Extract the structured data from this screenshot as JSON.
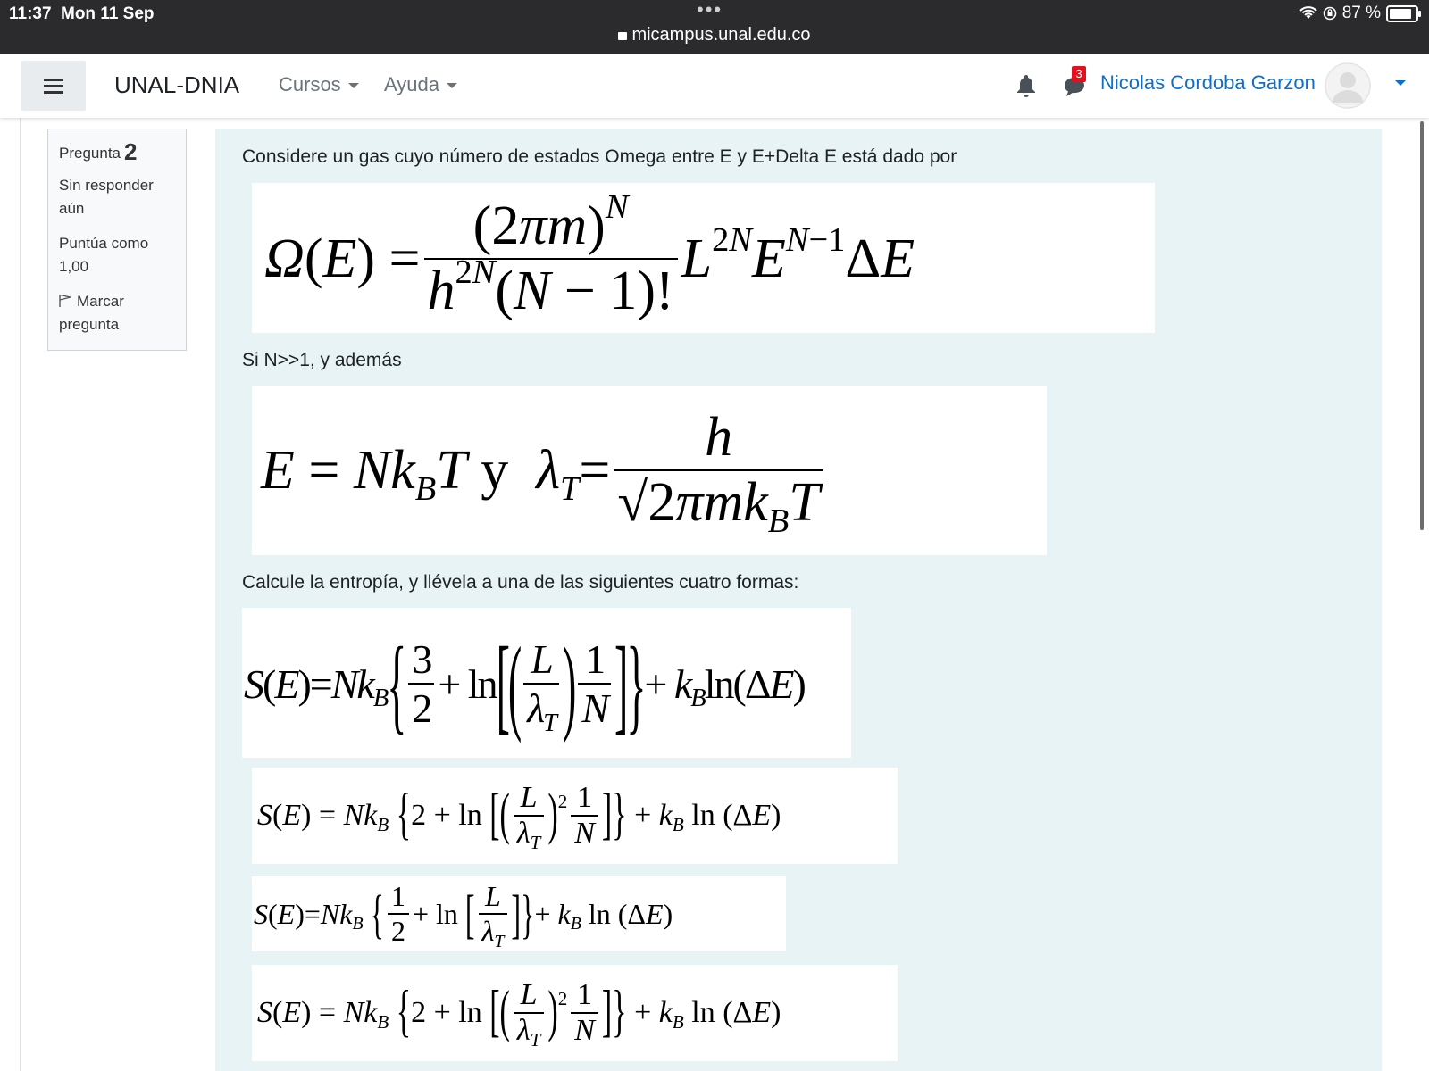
{
  "status_bar": {
    "time": "11:37",
    "date": "Mon 11 Sep",
    "url": "micampus.unal.edu.co",
    "battery": "87 %",
    "battery_level": 0.87
  },
  "navbar": {
    "brand": "UNAL-DNIA",
    "menu": [
      "Cursos",
      "Ayuda"
    ],
    "notification_count": "3",
    "username": "Nicolas Cordoba Garzon",
    "accent": "#0f6fc5"
  },
  "question_info": {
    "label": "Pregunta",
    "number": "2",
    "status_line1": "Sin responder",
    "status_line2": "aún",
    "points_line1": "Puntúa como",
    "points_line2": "1,00",
    "flag_line1": "Marcar",
    "flag_line2": "pregunta"
  },
  "question": {
    "intro": "Considere un gas cuyo número de estados Omega entre E y E+Delta E está dado por",
    "condition": "Si N>>1, y además",
    "instruction": "Calcule la entropía, y llévela a una de las siguientes cuatro formas:",
    "background": "#e7f3f5"
  }
}
